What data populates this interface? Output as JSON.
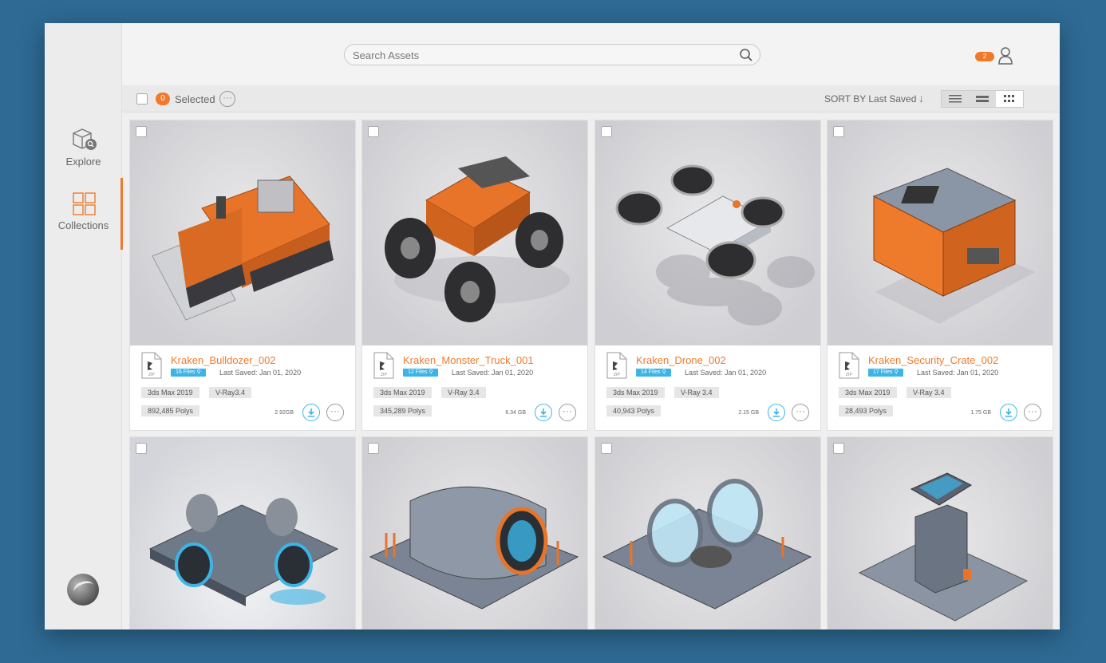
{
  "sidebar": {
    "items": [
      {
        "label": "Explore",
        "icon": "explore-box-search-icon"
      },
      {
        "label": "Collections",
        "icon": "grid-squares-icon",
        "active": true
      }
    ],
    "logo": "app-logo"
  },
  "header": {
    "search": {
      "placeholder": "Search Assets",
      "value": ""
    },
    "notification_count": "2"
  },
  "toolbar": {
    "selected_count": "0",
    "selected_label": "Selected",
    "sort_label": "SORT BY Last Saved",
    "view_modes": [
      "list",
      "compact-list",
      "grid"
    ],
    "active_view": "grid"
  },
  "colors": {
    "accent": "#f07a2a",
    "info": "#3cb4e6"
  },
  "assets": [
    {
      "title": "Kraken_Bulldozer_002",
      "files": "16 Files",
      "last_saved": "Last Saved: Jan 01, 2020",
      "software": "3ds Max 2019",
      "renderer": "V-Ray3.4",
      "polys": "892,485 Polys",
      "size": "2.92GB"
    },
    {
      "title": "Kraken_Monster_Truck_001",
      "files": "12 Files",
      "last_saved": "Last Saved: Jan 01, 2020",
      "software": "3ds Max 2019",
      "renderer": "V-Ray 3.4",
      "polys": "345,289 Polys",
      "size": "6.34 GB"
    },
    {
      "title": "Kraken_Drone_002",
      "files": "14 Files",
      "last_saved": "Last Saved: Jan 01, 2020",
      "software": "3ds Max 2019",
      "renderer": "V-Ray 3.4",
      "polys": "40,943 Polys",
      "size": "2.15 GB"
    },
    {
      "title": "Kraken_Security_Crate_002",
      "files": "17 Files",
      "last_saved": "Last Saved: Jan 01, 2020",
      "software": "3ds Max 2019",
      "renderer": "V-Ray 3.4",
      "polys": "28,493 Polys",
      "size": "1.75 GB"
    }
  ],
  "file_badge_label": "ZIP"
}
